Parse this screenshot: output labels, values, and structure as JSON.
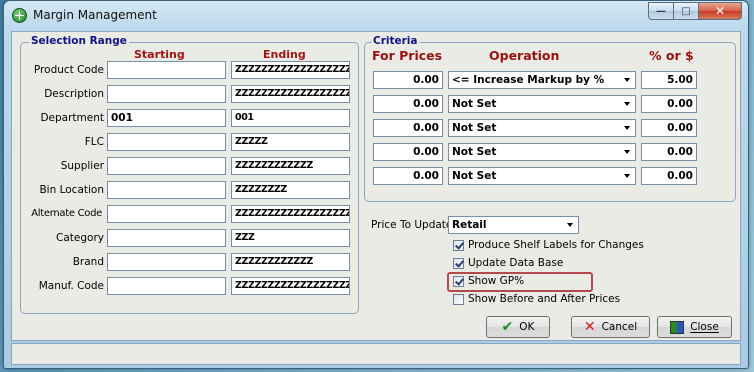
{
  "window": {
    "title": "Margin Management"
  },
  "selection": {
    "legend": "Selection Range",
    "starting_label": "Starting",
    "ending_label": "Ending",
    "rows": [
      {
        "label": "Product Code",
        "start": "",
        "end": "ZZZZZZZZZZZZZZZZZZZZ"
      },
      {
        "label": "Description",
        "start": "",
        "end": "ZZZZZZZZZZZZZZZZZZZZ"
      },
      {
        "label": "Department",
        "start": "001",
        "end": "001"
      },
      {
        "label": "FLC",
        "start": "",
        "end": "ZZZZZ"
      },
      {
        "label": "Supplier",
        "start": "",
        "end": "ZZZZZZZZZZZZ"
      },
      {
        "label": "Bin Location",
        "start": "",
        "end": "ZZZZZZZZ"
      },
      {
        "label": "Alternate Code",
        "start": "",
        "end": "ZZZZZZZZZZZZZZZZZZZZ"
      },
      {
        "label": "Category",
        "start": "",
        "end": "ZZZ"
      },
      {
        "label": "Brand",
        "start": "",
        "end": "ZZZZZZZZZZZZ"
      },
      {
        "label": "Manuf. Code",
        "start": "",
        "end": "ZZZZZZZZZZZZZZZZZZZZ"
      }
    ]
  },
  "criteria": {
    "legend": "Criteria",
    "for_prices_label": "For Prices",
    "operation_label": "Operation",
    "pct_label": "% or $",
    "rows": [
      {
        "price": "0.00",
        "operation": "<= Increase Markup by %",
        "value": "5.00"
      },
      {
        "price": "0.00",
        "operation": "Not Set",
        "value": "0.00"
      },
      {
        "price": "0.00",
        "operation": "Not Set",
        "value": "0.00"
      },
      {
        "price": "0.00",
        "operation": "Not Set",
        "value": "0.00"
      },
      {
        "price": "0.00",
        "operation": "Not Set",
        "value": "0.00"
      }
    ]
  },
  "options": {
    "price_to_update_label": "Price To Update",
    "price_to_update_value": "Retail",
    "checkboxes": [
      {
        "label": "Produce Shelf Labels for Changes",
        "checked": true
      },
      {
        "label": "Update Data Base",
        "checked": true
      },
      {
        "label": "Show GP%",
        "checked": true
      },
      {
        "label": "Show Before and After Prices",
        "checked": false
      }
    ]
  },
  "buttons": {
    "ok": "OK",
    "cancel": "Cancel",
    "close": "Close"
  },
  "colors": {
    "legend": "#11118a",
    "header_red": "#a31414",
    "highlight": "#b5484d"
  }
}
